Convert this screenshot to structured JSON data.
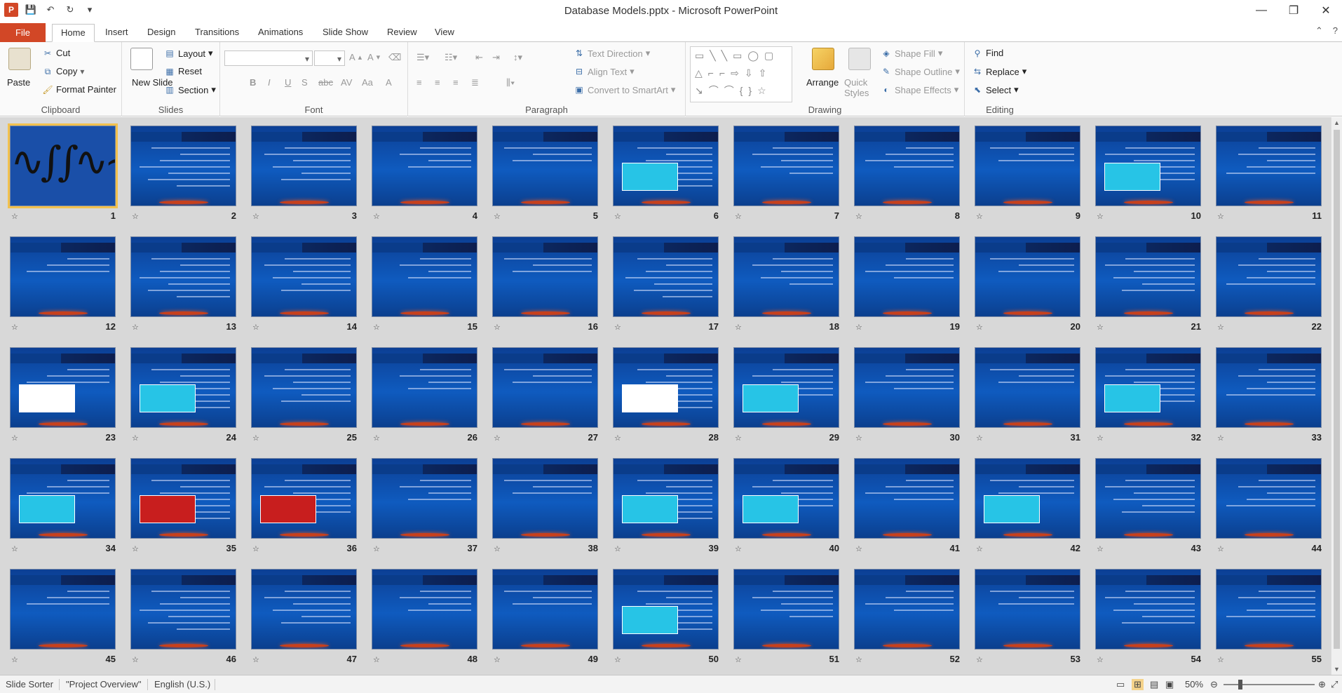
{
  "window": {
    "title": "Database Models.pptx  -  Microsoft PowerPoint",
    "controls": [
      "—",
      "❐",
      "✕"
    ]
  },
  "qat": {
    "app_icon": "P",
    "save": "💾",
    "undo": "↶",
    "redo": "↻",
    "customize": "▾"
  },
  "tabs": [
    "File",
    "Home",
    "Insert",
    "Design",
    "Transitions",
    "Animations",
    "Slide Show",
    "Review",
    "View"
  ],
  "active_tab": "Home",
  "ribbon": {
    "clipboard": {
      "label": "Clipboard",
      "paste": "Paste",
      "cut": "Cut",
      "copy": "Copy",
      "format_painter": "Format Painter"
    },
    "slides": {
      "label": "Slides",
      "new_slide": "New Slide",
      "layout": "Layout",
      "reset": "Reset",
      "section": "Section"
    },
    "font": {
      "label": "Font",
      "font_name": "",
      "font_size": "",
      "bold": "B",
      "italic": "I",
      "underline": "U",
      "shadow": "S",
      "strike": "abc",
      "spacing": "AV",
      "case": "Aa",
      "color": "A"
    },
    "paragraph": {
      "label": "Paragraph",
      "text_direction": "Text Direction",
      "align_text": "Align Text",
      "smartart": "Convert to SmartArt"
    },
    "drawing": {
      "label": "Drawing",
      "arrange": "Arrange",
      "quick_styles": "Quick Styles",
      "shape_fill": "Shape Fill",
      "shape_outline": "Shape Outline",
      "shape_effects": "Shape Effects"
    },
    "editing": {
      "label": "Editing",
      "find": "Find",
      "replace": "Replace",
      "select": "Select"
    }
  },
  "slides": [
    "1",
    "2",
    "3",
    "4",
    "5",
    "6",
    "7",
    "8",
    "9",
    "10",
    "11",
    "12",
    "13",
    "14",
    "15",
    "16",
    "17",
    "18",
    "19",
    "20",
    "21",
    "22",
    "23",
    "24",
    "25",
    "26",
    "27",
    "28",
    "29",
    "30",
    "31",
    "32",
    "33",
    "34",
    "35",
    "36",
    "37",
    "38",
    "39",
    "40",
    "41",
    "42",
    "43",
    "44",
    "45",
    "46",
    "47",
    "48",
    "49",
    "50",
    "51",
    "52",
    "53",
    "54",
    "55"
  ],
  "selected_slide": "1",
  "status": {
    "view": "Slide Sorter",
    "theme": "\"Project Overview\"",
    "language": "English (U.S.)",
    "zoom": "50%"
  }
}
